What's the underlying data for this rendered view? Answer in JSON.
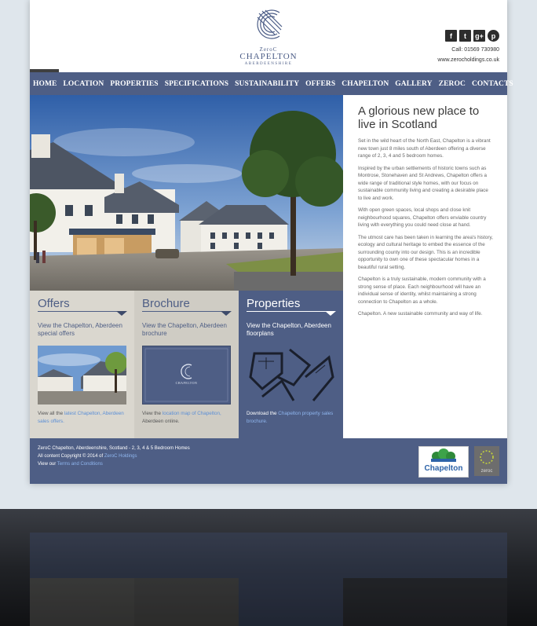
{
  "header": {
    "logo": {
      "small": "ZeroC",
      "name": "CHAPELTON",
      "sub": "ABERDEENSHIRE"
    },
    "social": [
      {
        "icon": "facebook-icon",
        "glyph": "f"
      },
      {
        "icon": "twitter-icon",
        "glyph": "t"
      },
      {
        "icon": "google-plus-icon",
        "glyph": "g+"
      },
      {
        "icon": "pinterest-icon",
        "glyph": "p"
      }
    ],
    "call": "Call: 01569 730980",
    "website": "www.zerocholdings.co.uk"
  },
  "nav": {
    "items": [
      "HOME",
      "LOCATION",
      "PROPERTIES",
      "SPECIFICATIONS",
      "SUSTAINABILITY",
      "OFFERS",
      "CHAPELTON",
      "GALLERY",
      "ZEROC",
      "CONTACTS"
    ]
  },
  "intro": {
    "title": "A glorious new place to live in Scotland",
    "paragraphs": [
      "Set in the wild heart of the North East, Chapelton is a vibrant new town just 8 miles south of Aberdeen offering a diverse range of 2, 3, 4 and 5 bedroom homes.",
      "Inspired by the urban settlements of historic towns such as Montrose, Stonehaven and St Andrews, Chapelton offers a wide range of traditional style homes, with our focus on sustainable community living and creating a desirable place to live and work.",
      "With open green spaces, local shops and close knit neighbourhood squares, Chapelton offers enviable country living with everything you could need close at hand.",
      "The utmost care has been taken in learning the area's history, ecology and cultural heritage to embed the essence of the surrounding county into our design. This is an incredible opportunity to own one of these spectacular homes in a beautiful rural setting.",
      "Chapelton is a truly sustainable, modern community with a strong sense of place. Each neighbourhood will have an individual sense of identity, whilst maintaining a strong connection to Chapelton as a whole.",
      "Chapelton. A new sustainable community and way of life."
    ]
  },
  "boxes": {
    "offers": {
      "title": "Offers",
      "desc": "View the Chapelton, Aberdeen special offers",
      "foot_pre": "View all the ",
      "foot_link": "latest Chapelton, Aberdeen sales offers.",
      "foot_post": ""
    },
    "brochure": {
      "title": "Brochure",
      "desc": "View the Chapelton, Aberdeen brochure",
      "foot_pre": "View the ",
      "foot_link": "location map of Chapelton,",
      "foot_post": " Aberdeen online.",
      "cover_name": "CHAPELTON"
    },
    "properties": {
      "title": "Properties",
      "desc": "View the Chapelton, Aberdeen floorplans",
      "foot_pre": "Download the ",
      "foot_link": "Chapelton property sales brochure.",
      "foot_post": ""
    }
  },
  "footer": {
    "line1": "ZeroC Chapelton, Aberdeenshire, Scotland - 2, 3, 4 & 5 Bedroom Homes",
    "line2_pre": "All content Copyright © 2014 of ",
    "line2_link": "ZeroC Holdings",
    "line3_pre": "View our ",
    "line3_link": "Terms and Conditions",
    "chapelton_logo": "Chapelton",
    "zeroc_logo": "zeroc"
  },
  "colors": {
    "nav": "#4e5e85",
    "link": "#5c8fd6",
    "offers_bg": "#dad7cf",
    "brochure_bg": "#cfccc4",
    "properties_bg": "#4e5e85"
  }
}
